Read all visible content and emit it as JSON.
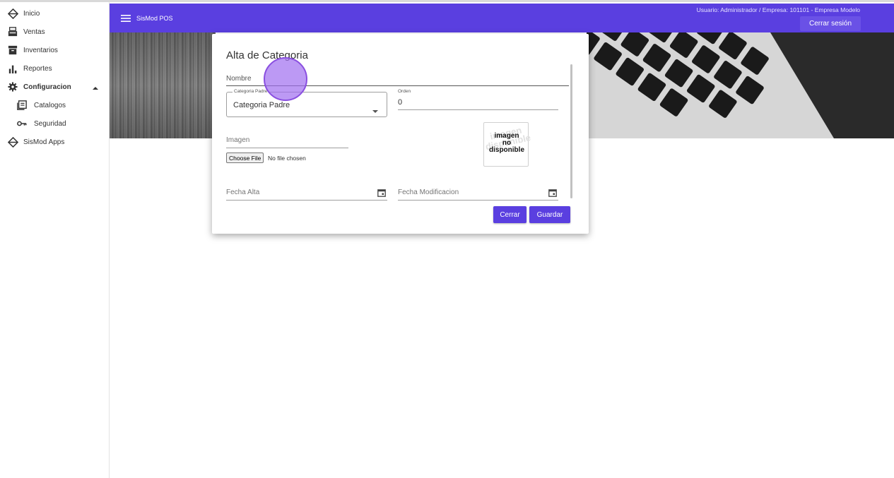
{
  "sidebar": {
    "items": [
      {
        "label": "Inicio",
        "icon": "tag-icon"
      },
      {
        "label": "Ventas",
        "icon": "register-icon"
      },
      {
        "label": "Inventarios",
        "icon": "archive-icon"
      },
      {
        "label": "Reportes",
        "icon": "bar-chart-icon"
      },
      {
        "label": "Configuracion",
        "icon": "gear-icon",
        "expanded": true
      },
      {
        "label": "Catalogos",
        "icon": "list-icon"
      },
      {
        "label": "Seguridad",
        "icon": "key-icon"
      },
      {
        "label": "SisMod Apps",
        "icon": "tag-icon"
      }
    ]
  },
  "topbar": {
    "title": "SisMod POS",
    "user_info": "Usuario: Administrador / Empresa: 101101 - Empresa Modelo",
    "logout_label": "Cerrar sesión",
    "color": "#5a3fe0"
  },
  "dialog": {
    "title": "Alta de Categoria",
    "nombre_label": "Nombre",
    "categoria_padre_label": "Categoria Padre",
    "categoria_padre_value": "Categoria Padre",
    "orden_label": "Orden",
    "orden_value": "0",
    "imagen_label": "Imagen",
    "file_button": "Choose File",
    "file_status": "No file chosen",
    "no_image_ghost": "imagen disponible",
    "no_image_line1": "imagen",
    "no_image_line2": "no",
    "no_image_line3": "disponible",
    "fecha_alta_label": "Fecha Alta",
    "fecha_mod_label": "Fecha Modificacion",
    "close_label": "Cerrar",
    "save_label": "Guardar"
  }
}
